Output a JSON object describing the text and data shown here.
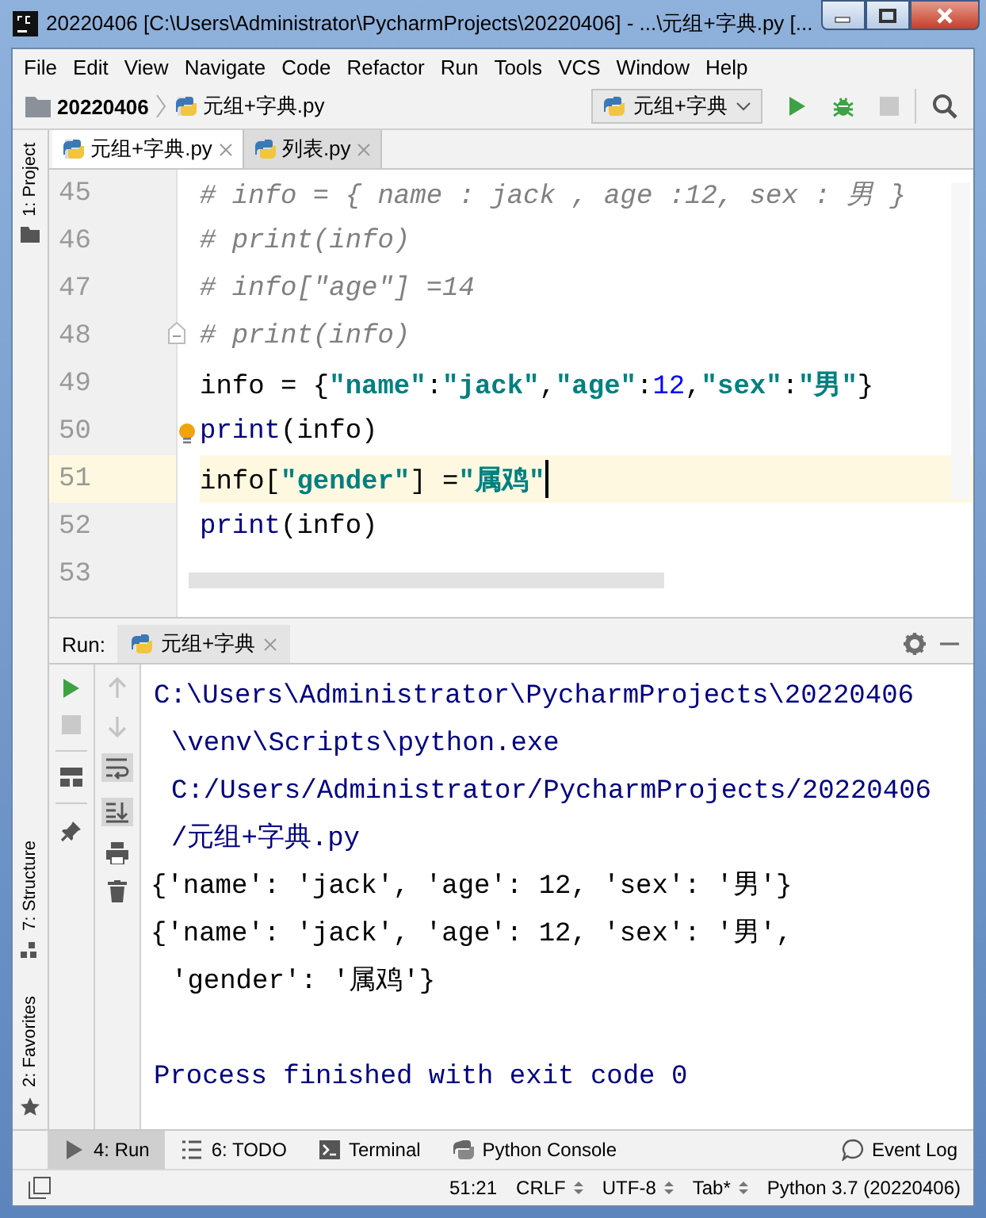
{
  "window": {
    "title": "20220406 [C:\\Users\\Administrator\\PycharmProjects\\20220406] - ...\\元组+字典.py [..."
  },
  "menu": [
    "File",
    "Edit",
    "View",
    "Navigate",
    "Code",
    "Refactor",
    "Run",
    "Tools",
    "VCS",
    "Window",
    "Help"
  ],
  "breadcrumbs": [
    {
      "kind": "folder",
      "label": "20220406"
    },
    {
      "kind": "file",
      "label": "元组+字典.py"
    }
  ],
  "run_config": {
    "label": "元组+字典"
  },
  "editor_tabs": [
    {
      "label": "元组+字典.py",
      "selected": true
    },
    {
      "label": "列表.py",
      "selected": false
    }
  ],
  "side_tools": {
    "top": [
      {
        "label": "1: Project"
      }
    ],
    "bottom": [
      {
        "label": "7: Structure"
      },
      {
        "label": "2: Favorites"
      }
    ]
  },
  "editor": {
    "lines": [
      {
        "number": "45",
        "current": false,
        "tokens": [
          {
            "kind": "comment",
            "text": "# info = { name : jack , age :12, sex : 男 }"
          }
        ]
      },
      {
        "number": "46",
        "current": false,
        "tokens": [
          {
            "kind": "comment",
            "text": "# print(info)"
          }
        ]
      },
      {
        "number": "47",
        "current": false,
        "tokens": [
          {
            "kind": "comment",
            "text": "# info[\"age\"] =14"
          }
        ]
      },
      {
        "number": "48",
        "current": false,
        "fold": true,
        "tokens": [
          {
            "kind": "comment",
            "text": "# print(info)"
          }
        ]
      },
      {
        "number": "49",
        "current": false,
        "tokens": [
          {
            "kind": "plain",
            "text": "info = {"
          },
          {
            "kind": "string",
            "text": "\"name\""
          },
          {
            "kind": "plain",
            "text": ":"
          },
          {
            "kind": "string",
            "text": "\"jack\""
          },
          {
            "kind": "plain",
            "text": ","
          },
          {
            "kind": "string",
            "text": "\"age\""
          },
          {
            "kind": "plain",
            "text": ":"
          },
          {
            "kind": "number",
            "text": "12"
          },
          {
            "kind": "plain",
            "text": ","
          },
          {
            "kind": "string",
            "text": "\"sex\""
          },
          {
            "kind": "plain",
            "text": ":"
          },
          {
            "kind": "string",
            "text": "\"男\""
          },
          {
            "kind": "plain",
            "text": "}"
          }
        ]
      },
      {
        "number": "50",
        "current": false,
        "bulb": true,
        "tokens": [
          {
            "kind": "builtin",
            "text": "print"
          },
          {
            "kind": "plain",
            "text": "(info)"
          }
        ]
      },
      {
        "number": "51",
        "current": true,
        "tokens": [
          {
            "kind": "plain",
            "text": "info["
          },
          {
            "kind": "string",
            "text": "\"gender\""
          },
          {
            "kind": "plain",
            "text": "] ="
          },
          {
            "kind": "string",
            "text": "\"属鸡\""
          }
        ]
      },
      {
        "number": "52",
        "current": false,
        "tokens": [
          {
            "kind": "builtin",
            "text": "print"
          },
          {
            "kind": "plain",
            "text": "(info)"
          }
        ]
      },
      {
        "number": "53",
        "current": false
      }
    ]
  },
  "run_panel": {
    "title": "Run:",
    "tab": "元组+字典",
    "toggles": [
      {
        "kind": "soft-wrap",
        "selected": true
      },
      {
        "kind": "scroll-end",
        "selected": true
      }
    ],
    "output": [
      {
        "kind": "system",
        "text": "C:\\Users\\Administrator\\PycharmProjects\\20220406"
      },
      {
        "kind": "system-wrap",
        "text": "\\venv\\Scripts\\python.exe"
      },
      {
        "kind": "system-wrap",
        "text": "C:/Users/Administrator/PycharmProjects/20220406"
      },
      {
        "kind": "system-wrap",
        "text": "/元组+字典.py"
      },
      {
        "kind": "stdout",
        "text": "{'name': 'jack', 'age': 12, 'sex': '男'}"
      },
      {
        "kind": "stdout",
        "text": "{'name': 'jack', 'age': 12, 'sex': '男',"
      },
      {
        "kind": "stdout-wrap",
        "text": "'gender': '属鸡'}"
      },
      {
        "kind": "exit",
        "text": "Process finished with exit code 0"
      }
    ]
  },
  "tool_windows": [
    {
      "label": "4: Run",
      "selected": true
    },
    {
      "label": "6: TODO",
      "selected": false
    },
    {
      "label": "Terminal",
      "selected": false
    },
    {
      "label": "Python Console",
      "selected": false
    }
  ],
  "event_log": {
    "label": "Event Log"
  },
  "status_bar": [
    {
      "text": "51:21",
      "dropdown": false
    },
    {
      "text": "CRLF",
      "dropdown": true
    },
    {
      "text": "UTF-8",
      "dropdown": true
    },
    {
      "text": "Tab*",
      "dropdown": true
    },
    {
      "text": "Python 3.7 (20220406)",
      "dropdown": false
    }
  ]
}
